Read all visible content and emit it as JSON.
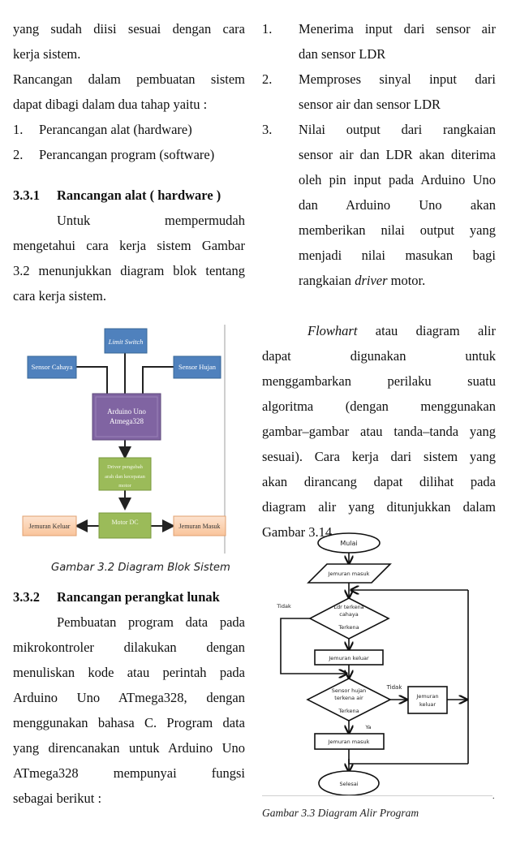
{
  "left_column": {
    "intro_lines": [
      "yang sudah diisi sesuai dengan cara",
      "kerja sistem."
    ],
    "para2_lines": [
      "Rancangan dalam pembuatan sistem",
      "dapat dibagi dalam dua tahap yaitu :"
    ],
    "list": [
      {
        "num": "1.",
        "text": "Perancangan alat (hardware)"
      },
      {
        "num": "2.",
        "text": "Perancangan program (software)"
      }
    ],
    "section_331": {
      "number": "3.3.1",
      "title": "Rancangan alat ( hardware )"
    },
    "para3_lines": [
      "Untuk mempermudah",
      "mengetahui cara kerja sistem Gambar",
      "3.2 menunjukkan diagram blok tentang",
      "cara kerja sistem."
    ],
    "block_diagram": {
      "limit_switch": "Limit Switch",
      "sensor_cahaya": "Sensor Cahaya",
      "sensor_hujan": "Sensor Hujan",
      "arduino_line1": "Arduino Uno",
      "arduino_line2": "Atmega328",
      "driver_line1": "Driver pengubah",
      "driver_line2": "arah dan kecepatan",
      "driver_line3": "motor",
      "motor": "Motor DC",
      "jemuran_keluar": "Jemuran Keluar",
      "jemuran_masuk": "Jemuran Masuk",
      "colors": {
        "blue": "#4f81bd",
        "purple": "#8064a2",
        "green": "#9bbb59",
        "orange": "#fbd5b5"
      }
    },
    "figure_32_caption": "Gambar 3.2 Diagram Blok Sistem",
    "section_332": {
      "number": "3.3.2",
      "title": "Rancangan perangkat lunak"
    },
    "para4_lines": [
      "Pembuatan program data pada",
      "mikrokontroler dilakukan dengan",
      "menuliskan kode atau perintah pada",
      "Arduino Uno ATmega328, dengan",
      "menggunakan bahasa C. Program data",
      "yang direncanakan untuk Arduino Uno",
      "ATmega328 mempunyai fungsi",
      "sebagai berikut :"
    ]
  },
  "right_column": {
    "list": [
      {
        "num": "1.",
        "lines": [
          "Menerima input dari sensor air",
          "dan sensor LDR"
        ]
      },
      {
        "num": "2.",
        "lines": [
          "Memproses sinyal input dari",
          "sensor air dan sensor LDR"
        ]
      },
      {
        "num": "3.",
        "lines": [
          "Nilai output dari rangkaian",
          "sensor air dan LDR akan diterima",
          "oleh pin input pada Arduino Uno",
          "dan Arduino Uno akan",
          "memberikan nilai output yang",
          "menjadi nilai masukan bagi"
        ]
      }
    ],
    "item3_last_pre": "rangkaian ",
    "item3_last_em": "driver",
    "item3_last_post": " motor.",
    "flowchart_para_em": "Flowhart",
    "flowchart_para_first_rest": " atau diagram alir",
    "flowchart_para_lines": [
      "dapat digunakan untuk",
      "menggambarkan perilaku suatu",
      "algoritma (dengan menggunakan",
      "gambar–gambar atau tanda–tanda yang",
      "sesuai). Cara kerja dari sistem yang",
      "akan dirancang dapat dilihat pada",
      "diagram alir yang ditunjukkan dalam",
      "Gambar 3.14."
    ],
    "flowchart": {
      "start": "Mulai",
      "input1": "Jemuran masuk",
      "decision1_line1": "Ldr terkena",
      "decision1_line2": "cahaya",
      "decision1_yes": "Terkena",
      "decision1_no": "Tidak",
      "process1": "Jemuran keluar",
      "decision2_line1": "Sensor hujan",
      "decision2_line2": "terkena air",
      "decision2_yes_inner": "Terkena",
      "decision2_no": "Tidak",
      "decision2_yes": "Ya",
      "process2_line1": "Jemuran",
      "process2_line2": "keluar",
      "process3": "Jemuran masuk",
      "end": "Selesai"
    },
    "figure_33_caption": "Gambar 3.3  Diagram Alir Program"
  }
}
